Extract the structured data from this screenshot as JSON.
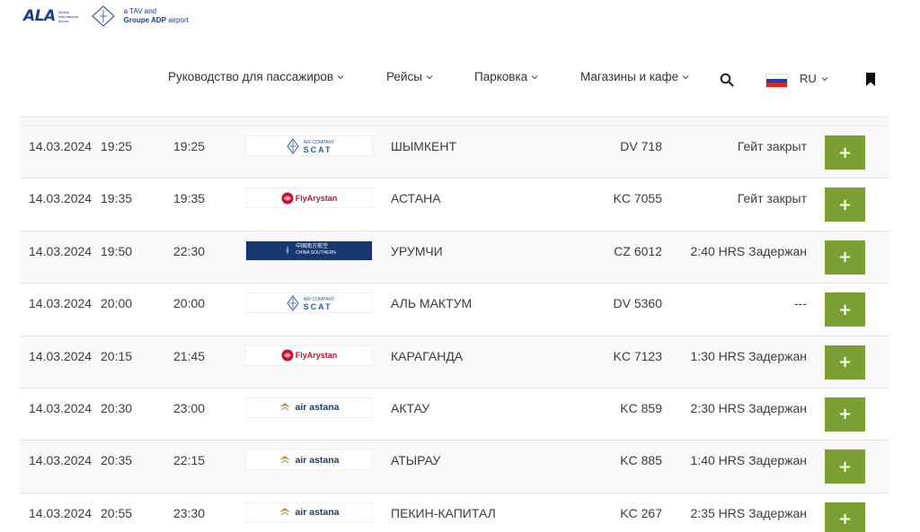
{
  "header": {
    "logo_ala": "ALA",
    "logo_sub": "Almaty International Airport",
    "logo_tav_line1": "a TAV and",
    "logo_tav_line2": "Groupe ADP",
    "logo_tav_line3": "airport"
  },
  "nav": {
    "items": [
      {
        "label": "Руководство для пассажиров"
      },
      {
        "label": "Рейсы"
      },
      {
        "label": "Парковка"
      },
      {
        "label": "Магазины и кафе"
      }
    ],
    "search_icon": "search-icon",
    "language": "RU",
    "flag_colors": [
      "#ffffff",
      "#1c3fa8",
      "#d52b1e"
    ],
    "bookmark_icon": "bookmark-icon"
  },
  "colors": {
    "accent_green": "#7aa033",
    "brand_blue": "#1b3f8f"
  },
  "flights": [
    {
      "date": "14.03.2024",
      "scheduled": "19:25",
      "estimated": "19:25",
      "airline": "SCAT",
      "airline_text": "SCAT",
      "airline_small": "AIR COMPANY",
      "city": "ШЫМКЕНТ",
      "flight": "DV 718",
      "status": "Гейт закрыт",
      "action": "+"
    },
    {
      "date": "14.03.2024",
      "scheduled": "19:35",
      "estimated": "19:35",
      "airline": "FlyArystan",
      "airline_text": "FlyArystan",
      "airline_small": "",
      "city": "АСТАНА",
      "flight": "KC 7055",
      "status": "Гейт закрыт",
      "action": "+"
    },
    {
      "date": "14.03.2024",
      "scheduled": "19:50",
      "estimated": "22:30",
      "airline": "China Southern",
      "airline_text": "CHINA SOUTHERN",
      "airline_small": "中国南方航空",
      "city": "УРУМЧИ",
      "flight": "CZ 6012",
      "status": "2:40 HRS Задержан",
      "action": "+"
    },
    {
      "date": "14.03.2024",
      "scheduled": "20:00",
      "estimated": "20:00",
      "airline": "SCAT",
      "airline_text": "SCAT",
      "airline_small": "AIR COMPANY",
      "city": "АЛЬ МАКТУМ",
      "flight": "DV 5360",
      "status": "---",
      "action": "+"
    },
    {
      "date": "14.03.2024",
      "scheduled": "20:15",
      "estimated": "21:45",
      "airline": "FlyArystan",
      "airline_text": "FlyArystan",
      "airline_small": "",
      "city": "КАРАГАНДА",
      "flight": "KC 7123",
      "status": "1:30 HRS Задержан",
      "action": "+"
    },
    {
      "date": "14.03.2024",
      "scheduled": "20:30",
      "estimated": "23:00",
      "airline": "Air Astana",
      "airline_text": "air astana",
      "airline_small": "",
      "city": "АКТАУ",
      "flight": "KC 859",
      "status": "2:30 HRS Задержан",
      "action": "+"
    },
    {
      "date": "14.03.2024",
      "scheduled": "20:35",
      "estimated": "22:15",
      "airline": "Air Astana",
      "airline_text": "air astana",
      "airline_small": "",
      "city": "АТЫРАУ",
      "flight": "KC 885",
      "status": "1:40 HRS Задержан",
      "action": "+"
    },
    {
      "date": "14.03.2024",
      "scheduled": "20:55",
      "estimated": "23:30",
      "airline": "Air Astana",
      "airline_text": "air astana",
      "airline_small": "",
      "city": "ПЕКИН-КАПИТАЛ",
      "flight": "KC 267",
      "status": "2:35 HRS Задержан",
      "action": "+"
    }
  ]
}
